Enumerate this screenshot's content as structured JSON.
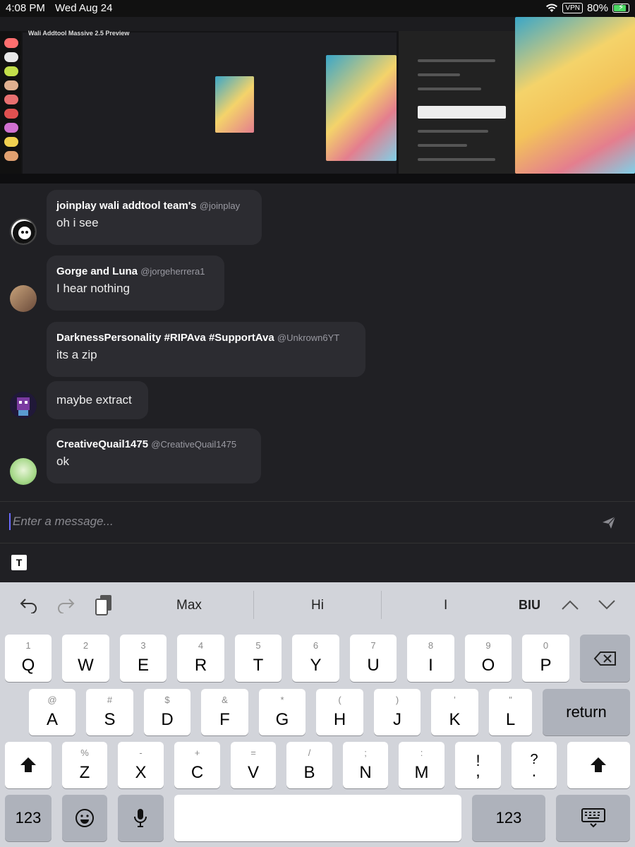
{
  "status_bar": {
    "time": "4:08 PM",
    "date": "Wed Aug 24",
    "vpn": "VPN",
    "battery": "80%"
  },
  "screenshot_image": {
    "title": "Wali Addtool Massive 2.5 Preview"
  },
  "messages": [
    {
      "username": "joinplay wali addtool team's",
      "handle": "@joinplay",
      "lines": [
        "oh i see"
      ]
    },
    {
      "username": "Gorge and Luna",
      "handle": "@jorgeherrera1",
      "lines": [
        "I hear nothing"
      ]
    },
    {
      "username": "DarknessPersonality #RIPAva #SupportAva",
      "handle": "@Unkrown6YT",
      "lines": [
        "its a zip",
        "maybe extract"
      ]
    },
    {
      "username": "CreativeQuail1475",
      "handle": "@CreativeQuail1475",
      "lines": [
        "ok"
      ]
    }
  ],
  "composer": {
    "placeholder": "Enter a message..."
  },
  "keyboard": {
    "suggestions": [
      "Max",
      "Hi",
      "I"
    ],
    "format_label": "BIU",
    "row1": [
      {
        "sub": "1",
        "main": "Q"
      },
      {
        "sub": "2",
        "main": "W"
      },
      {
        "sub": "3",
        "main": "E"
      },
      {
        "sub": "4",
        "main": "R"
      },
      {
        "sub": "5",
        "main": "T"
      },
      {
        "sub": "6",
        "main": "Y"
      },
      {
        "sub": "7",
        "main": "U"
      },
      {
        "sub": "8",
        "main": "I"
      },
      {
        "sub": "9",
        "main": "O"
      },
      {
        "sub": "0",
        "main": "P"
      }
    ],
    "row2": [
      {
        "sub": "@",
        "main": "A"
      },
      {
        "sub": "#",
        "main": "S"
      },
      {
        "sub": "$",
        "main": "D"
      },
      {
        "sub": "&",
        "main": "F"
      },
      {
        "sub": "*",
        "main": "G"
      },
      {
        "sub": "(",
        "main": "H"
      },
      {
        "sub": ")",
        "main": "J"
      },
      {
        "sub": "’",
        "main": "K"
      },
      {
        "sub": "\"",
        "main": "L"
      }
    ],
    "row3": [
      {
        "sub": "%",
        "main": "Z"
      },
      {
        "sub": "-",
        "main": "X"
      },
      {
        "sub": "+",
        "main": "C"
      },
      {
        "sub": "=",
        "main": "V"
      },
      {
        "sub": "/",
        "main": "B"
      },
      {
        "sub": ";",
        "main": "N"
      },
      {
        "sub": ":",
        "main": "M"
      },
      {
        "sub": "!",
        "main": ","
      },
      {
        "sub": "?",
        "main": "."
      }
    ],
    "return_label": "return",
    "numbers_label": "123"
  }
}
